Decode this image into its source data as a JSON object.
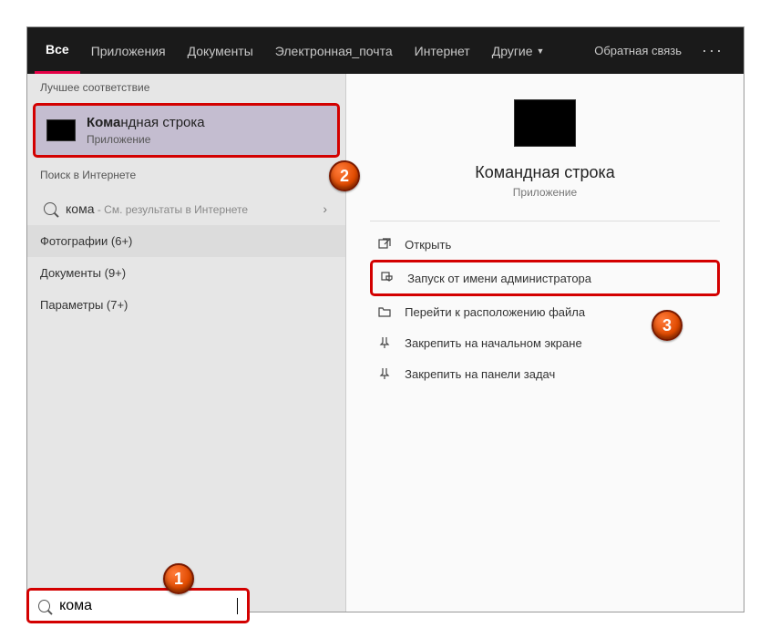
{
  "tabs": {
    "all": "Все",
    "apps": "Приложения",
    "docs": "Документы",
    "email": "Электронная_почта",
    "internet": "Интернет",
    "more": "Другие",
    "feedback": "Обратная связь"
  },
  "left": {
    "best_match_header": "Лучшее соответствие",
    "best_match": {
      "title_prefix": "Кома",
      "title_rest": "ндная строка",
      "subtitle": "Приложение"
    },
    "web_header": "Поиск в Интернете",
    "web_item": {
      "query": "кома",
      "hint": " - См. результаты в Интернете"
    },
    "photos": "Фотографии (6+)",
    "documents": "Документы (9+)",
    "params": "Параметры (7+)"
  },
  "right": {
    "title": "Командная строка",
    "subtitle": "Приложение",
    "actions": {
      "open": "Открыть",
      "run_admin": "Запуск от имени администратора",
      "file_location": "Перейти к расположению файла",
      "pin_start": "Закрепить на начальном экране",
      "pin_taskbar": "Закрепить на панели задач"
    }
  },
  "search": {
    "value": "кома"
  },
  "annotations": {
    "n1": "1",
    "n2": "2",
    "n3": "3"
  }
}
